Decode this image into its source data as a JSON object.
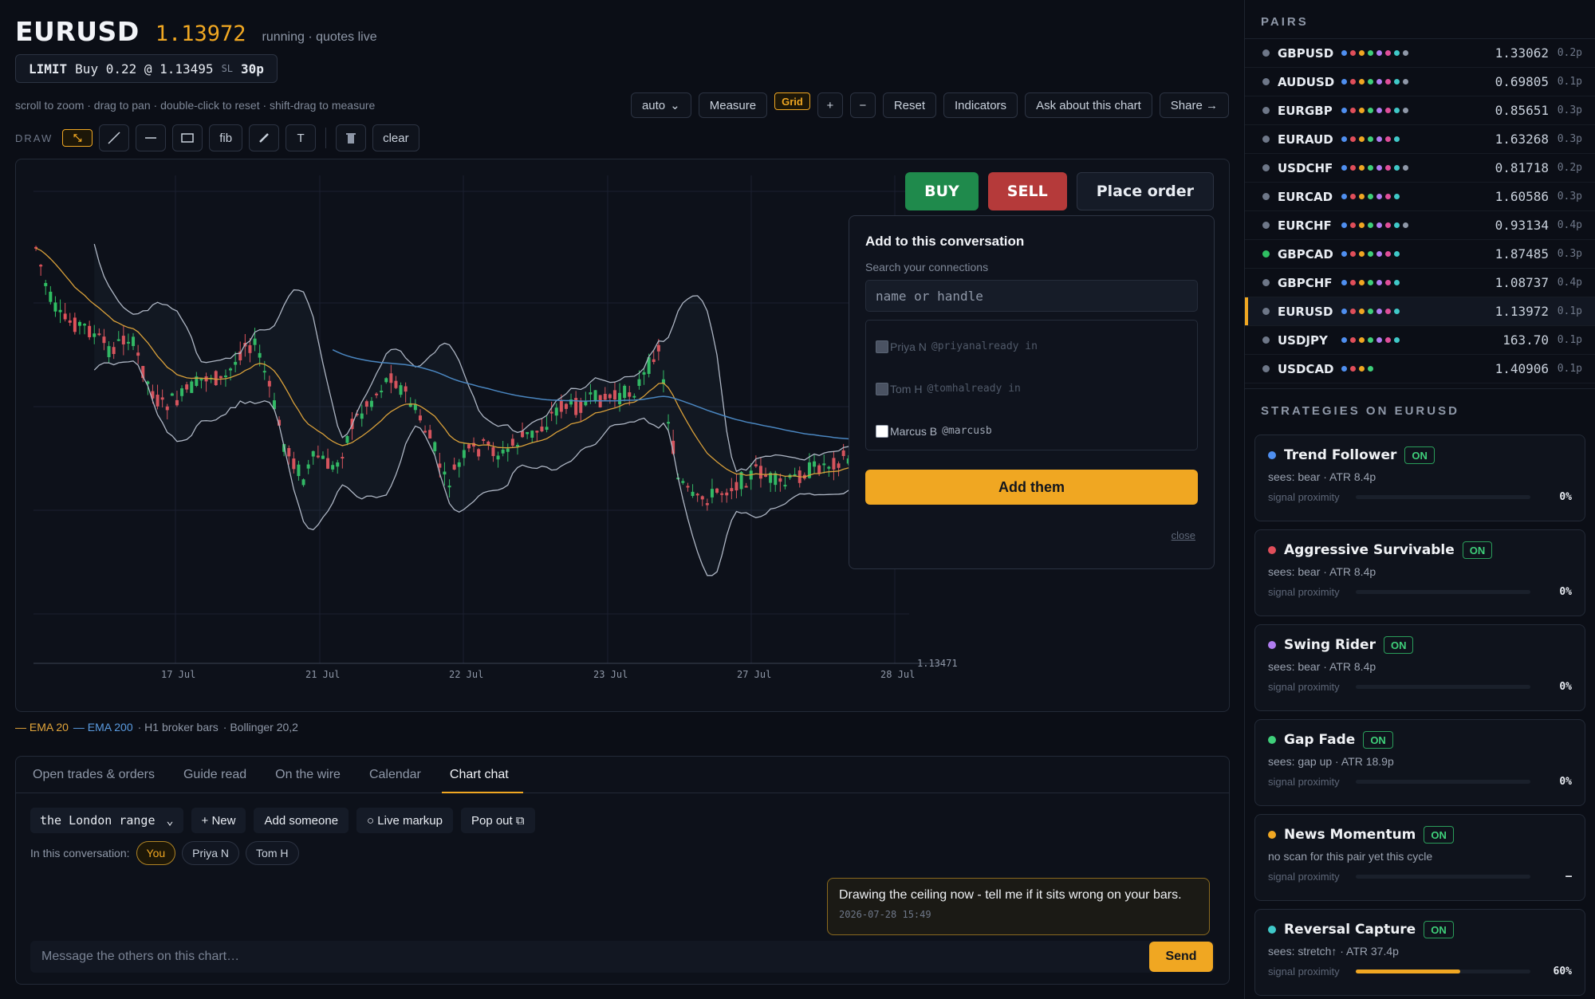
{
  "header": {
    "symbol": "EURUSD",
    "price": "1.13972",
    "status": "running · quotes live"
  },
  "order": {
    "type": "LIMIT",
    "side_size": "Buy 0.22 @ 1.13495",
    "sl_label": "SL",
    "sl_value": "30p"
  },
  "hint": "scroll to zoom · drag to pan · double-click to reset · shift-drag to measure",
  "toolbar": {
    "mode": "auto",
    "measure": "Measure",
    "grid": "Grid",
    "zoom_in": "+",
    "zoom_out": "−",
    "reset": "Reset",
    "indicators": "Indicators",
    "ask": "Ask about this chart",
    "share": "Share →"
  },
  "draw": {
    "label": "DRAW",
    "fib": "fib",
    "text": "T",
    "clear": "clear"
  },
  "trade": {
    "buy": "BUY",
    "sell": "SELL",
    "place": "Place order"
  },
  "popup": {
    "title": "Add to this conversation",
    "search_label": "Search your connections",
    "search_placeholder": "name or handle",
    "connections": [
      {
        "name": "Priya N",
        "handle": "@priyanalready in",
        "disabled": true
      },
      {
        "name": "Tom H",
        "handle": "@tomhalready in",
        "disabled": true
      },
      {
        "name": "Marcus B",
        "handle": "@marcusb",
        "disabled": false
      }
    ],
    "add": "Add them",
    "close": "close"
  },
  "legend": {
    "ema20": "— EMA 20",
    "ema200": "— EMA 200",
    "bars": "· H1 broker bars",
    "boll": "· Bollinger 20,2"
  },
  "tabs": [
    "Open trades & orders",
    "Guide read",
    "On the wire",
    "Calendar",
    "Chart chat"
  ],
  "chat": {
    "room": "the London range",
    "new": "+ New",
    "add_someone": "Add someone",
    "live_markup": "○ Live markup",
    "pop_out": "Pop out ⧉",
    "in_conv_label": "In this conversation:",
    "members": [
      "You",
      "Priya N",
      "Tom H"
    ],
    "message": {
      "text": "Drawing the ceiling now - tell me if it sits wrong on your bars.",
      "time": "2026-07-28 15:49"
    },
    "placeholder": "Message the others on this chart…",
    "send": "Send"
  },
  "sidebar": {
    "pairs_title": "PAIRS",
    "pairs": [
      {
        "name": "GBPUSD",
        "price": "1.33062",
        "spread": "0.2p",
        "dot": "#6e7788",
        "n": 8
      },
      {
        "name": "AUDUSD",
        "price": "0.69805",
        "spread": "0.1p",
        "dot": "#6e7788",
        "n": 8
      },
      {
        "name": "EURGBP",
        "price": "0.85651",
        "spread": "0.3p",
        "dot": "#6e7788",
        "n": 8
      },
      {
        "name": "EURAUD",
        "price": "1.63268",
        "spread": "0.3p",
        "dot": "#6e7788",
        "n": 7
      },
      {
        "name": "USDCHF",
        "price": "0.81718",
        "spread": "0.2p",
        "dot": "#6e7788",
        "n": 8
      },
      {
        "name": "EURCAD",
        "price": "1.60586",
        "spread": "0.3p",
        "dot": "#6e7788",
        "n": 7
      },
      {
        "name": "EURCHF",
        "price": "0.93134",
        "spread": "0.4p",
        "dot": "#6e7788",
        "n": 8
      },
      {
        "name": "GBPCAD",
        "price": "1.87485",
        "spread": "0.3p",
        "dot": "#2fbf62",
        "n": 7
      },
      {
        "name": "GBPCHF",
        "price": "1.08737",
        "spread": "0.4p",
        "dot": "#6e7788",
        "n": 7
      },
      {
        "name": "EURUSD",
        "price": "1.13972",
        "spread": "0.1p",
        "dot": "#6e7788",
        "n": 7
      },
      {
        "name": "USDJPY",
        "price": "163.70",
        "spread": "0.1p",
        "dot": "#6e7788",
        "n": 7
      },
      {
        "name": "USDCAD",
        "price": "1.40906",
        "spread": "0.1p",
        "dot": "#6e7788",
        "n": 4
      }
    ],
    "dot_colors": [
      "#4f8ff0",
      "#e04e5a",
      "#f0a722",
      "#3fcf7a",
      "#b07cf0",
      "#e04e9a",
      "#3fc8c8",
      "#8f98a8"
    ],
    "strategies_title": "STRATEGIES ON EURUSD",
    "strategies": [
      {
        "name": "Trend Follower",
        "status": "ON",
        "sees": "sees: bear · ATR 8.4p",
        "prox_label": "signal proximity",
        "value": "0%",
        "fill": 0,
        "color": "#4f8ff0"
      },
      {
        "name": "Aggressive Survivable",
        "status": "ON",
        "sees": "sees: bear · ATR 8.4p",
        "prox_label": "signal proximity",
        "value": "0%",
        "fill": 0,
        "color": "#e04e5a"
      },
      {
        "name": "Swing Rider",
        "status": "ON",
        "sees": "sees: bear · ATR 8.4p",
        "prox_label": "signal proximity",
        "value": "0%",
        "fill": 0,
        "color": "#b07cf0"
      },
      {
        "name": "Gap Fade",
        "status": "ON",
        "sees": "sees: gap up · ATR 18.9p",
        "prox_label": "signal proximity",
        "value": "0%",
        "fill": 0,
        "color": "#3fcf7a"
      },
      {
        "name": "News Momentum",
        "status": "ON",
        "sees": "no scan for this pair yet this cycle",
        "prox_label": "signal proximity",
        "value": "–",
        "fill": 0,
        "color": "#f0a722"
      },
      {
        "name": "Reversal Capture",
        "status": "ON",
        "sees": "sees: stretch↑ · ATR 37.4p",
        "prox_label": "signal proximity",
        "value": "60%",
        "fill": 0.6,
        "color": "#3fc8c8"
      }
    ]
  },
  "chart_data": {
    "type": "candlestick",
    "x_ticks": [
      "17 Jul",
      "21 Jul",
      "22 Jul",
      "23 Jul",
      "27 Jul",
      "28 Jul"
    ],
    "price_labels": [
      "1.13471"
    ],
    "indicators": [
      "EMA 20",
      "EMA 200",
      "Bollinger 20,2"
    ]
  }
}
